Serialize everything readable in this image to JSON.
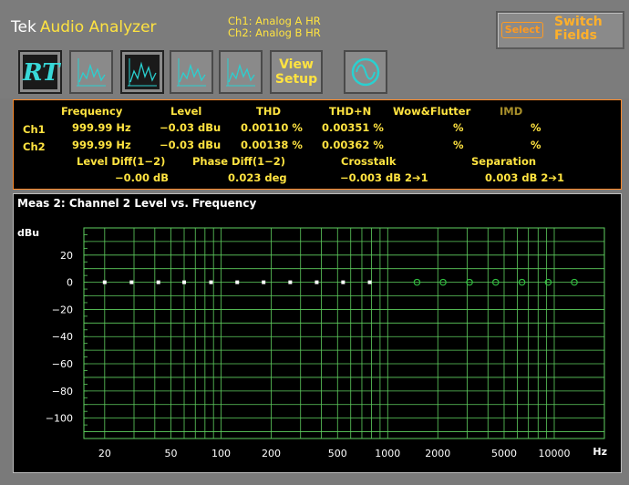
{
  "header": {
    "brand": "Tek",
    "app_title": "Audio Analyzer",
    "ch1": "Ch1: Analog A HR",
    "ch2": "Ch2: Analog B HR",
    "switch_select": "Select",
    "switch_label": "Switch Fields"
  },
  "toolbar": {
    "rt_label": "RT",
    "view_setup": "View Setup"
  },
  "results": {
    "headers": [
      "Frequency",
      "Level",
      "THD",
      "THD+N",
      "Wow&Flutter",
      "IMD"
    ],
    "ch1": {
      "label": "Ch1",
      "frequency": "999.99 Hz",
      "level": "−0.03 dBu",
      "thd": "0.00110 %",
      "thdn": "0.00351 %",
      "wow": "%",
      "imd": "%"
    },
    "ch2": {
      "label": "Ch2",
      "frequency": "999.99 Hz",
      "level": "−0.03 dBu",
      "thd": "0.00138 %",
      "thdn": "0.00362 %",
      "wow": "%",
      "imd": "%"
    },
    "headers2": [
      "Level Diff(1−2)",
      "Phase Diff(1−2)",
      "Crosstalk",
      "Separation"
    ],
    "level_diff": "−0.00 dB",
    "phase_diff": "0.023 deg",
    "crosstalk": "−0.003 dB 2➔1",
    "separation": "0.003 dB 2➔1"
  },
  "graph": {
    "title": "Meas 2: Channel 2 Level vs. Frequency",
    "ylabel": "dBu",
    "xunit": "Hz"
  },
  "chart_data": {
    "type": "scatter",
    "xscale": "log",
    "xlim": [
      15,
      20000
    ],
    "ylim": [
      -115,
      40
    ],
    "yticks": [
      20,
      0,
      -20,
      -40,
      -60,
      -80,
      -100
    ],
    "ytick_labels": [
      "20",
      "0",
      "−20",
      "−40",
      "−60",
      "−80",
      "−100"
    ],
    "xticks": [
      20,
      50,
      100,
      200,
      500,
      1000,
      2000,
      5000,
      10000
    ],
    "xtick_labels": [
      "20",
      "50",
      "100",
      "200",
      "500",
      "1000",
      "2000",
      "5000",
      "10000"
    ],
    "series": [
      {
        "marker": "square",
        "color": "#ffffff",
        "x": [
          20,
          29,
          42,
          60,
          87,
          125,
          180,
          260,
          375,
          540,
          780
        ],
        "y": [
          0,
          0,
          0,
          0,
          0,
          0,
          0,
          0,
          0,
          0,
          0
        ]
      },
      {
        "marker": "circle",
        "color": "#30c040",
        "x": [
          1500,
          2150,
          3100,
          4450,
          6400,
          9200,
          13200
        ],
        "y": [
          0,
          0,
          0,
          0,
          0,
          0,
          0
        ]
      }
    ],
    "grid": true,
    "colors": {
      "grid": "#5fcf5f",
      "text": "#ffffff"
    }
  }
}
